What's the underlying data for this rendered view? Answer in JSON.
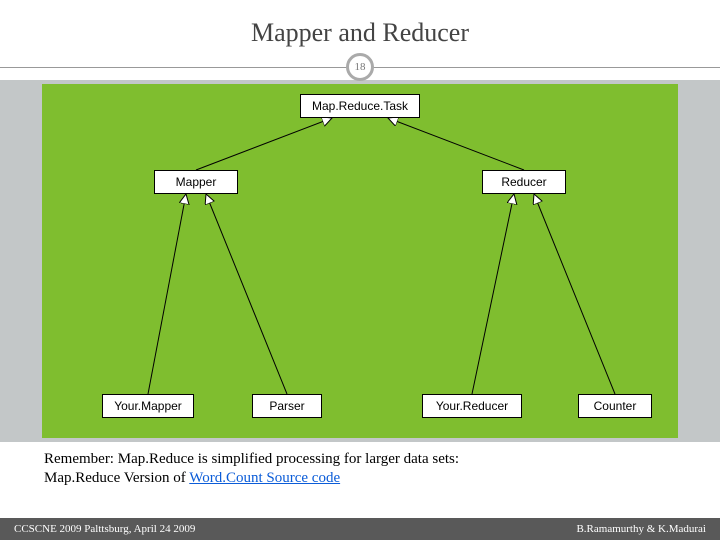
{
  "title": "Mapper and Reducer",
  "slide_number": "18",
  "diagram": {
    "nodes": {
      "root": "Map.Reduce.Task",
      "mapper": "Mapper",
      "reducer": "Reducer",
      "your_mapper": "Your.Mapper",
      "parser": "Parser",
      "your_reducer": "Your.Reducer",
      "counter": "Counter"
    }
  },
  "body": {
    "line1": "Remember: Map.Reduce is simplified processing for larger data sets:",
    "line2_prefix": "Map.Reduce Version of ",
    "link_text": "Word.Count Source code"
  },
  "footer": {
    "left": "CCSCNE 2009 Palttsburg, April 24 2009",
    "right": "B.Ramamurthy & K.Madurai"
  },
  "chart_data": {
    "type": "diagram",
    "title": "Mapper and Reducer class hierarchy",
    "nodes": [
      "Map.Reduce.Task",
      "Mapper",
      "Reducer",
      "Your.Mapper",
      "Parser",
      "Your.Reducer",
      "Counter"
    ],
    "edges": [
      {
        "from": "Mapper",
        "to": "Map.Reduce.Task",
        "relation": "generalization"
      },
      {
        "from": "Reducer",
        "to": "Map.Reduce.Task",
        "relation": "generalization"
      },
      {
        "from": "Your.Mapper",
        "to": "Mapper",
        "relation": "generalization"
      },
      {
        "from": "Parser",
        "to": "Mapper",
        "relation": "generalization"
      },
      {
        "from": "Your.Reducer",
        "to": "Reducer",
        "relation": "generalization"
      },
      {
        "from": "Counter",
        "to": "Reducer",
        "relation": "generalization"
      }
    ]
  }
}
